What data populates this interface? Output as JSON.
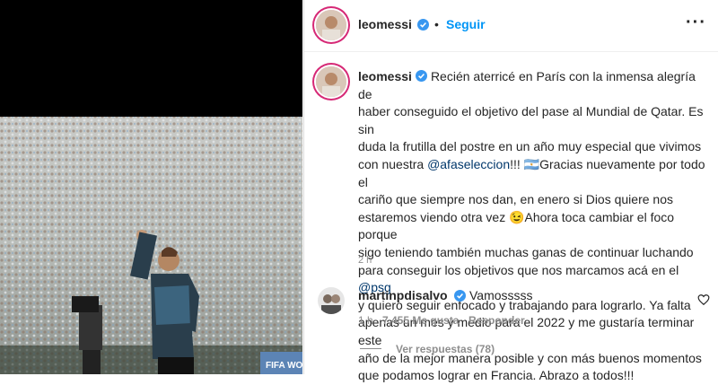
{
  "post": {
    "username": "leomessi",
    "separator": "•",
    "follow_label": "Seguir",
    "more_label": "···"
  },
  "caption": {
    "username": "leomessi",
    "line1": "Recién aterricé en París con la inmensa alegría de",
    "line2": "haber conseguido el objetivo del pase al Mundial de Qatar. Es sin",
    "line3": "duda la frutilla del postre en un año muy especial que vivimos",
    "line4_pre": "con nuestra ",
    "mention_afa": "@afaseleccion",
    "line4_post": "!!! 🇦🇷Gracias nuevamente por todo el",
    "line5": "cariño que siempre nos dan, en enero si Dios quiere nos",
    "line6": "estaremos viendo otra vez 😉Ahora toca cambiar el foco porque",
    "line7": "sigo teniendo también muchas ganas de continuar luchando",
    "line8_pre": "para conseguir los objetivos que nos marcamos acá en el ",
    "mention_psg": "@psg",
    "line9": "y quiero seguir enfocado y trabajando para lograrlo. Ya falta",
    "line10": "apenas un mes y medio para el 2022 y me gustaría terminar este",
    "line11": "año de la mejor manera posible y con más buenos momentos",
    "line12": "que podamos lograr en Francia. Abrazo a todos!!!",
    "time": "2 h"
  },
  "comment": {
    "username": "martinpdisalvo",
    "text": "Vamosssss",
    "time": "1 h",
    "likes": "7,455 Me gusta",
    "reply_label": "Responder",
    "view_replies": "Ver respuestas (78)"
  },
  "colors": {
    "accent": "#0095f6",
    "verified": "#3897f0",
    "mention": "#00376b",
    "secondary_text": "#8e8e8e"
  }
}
